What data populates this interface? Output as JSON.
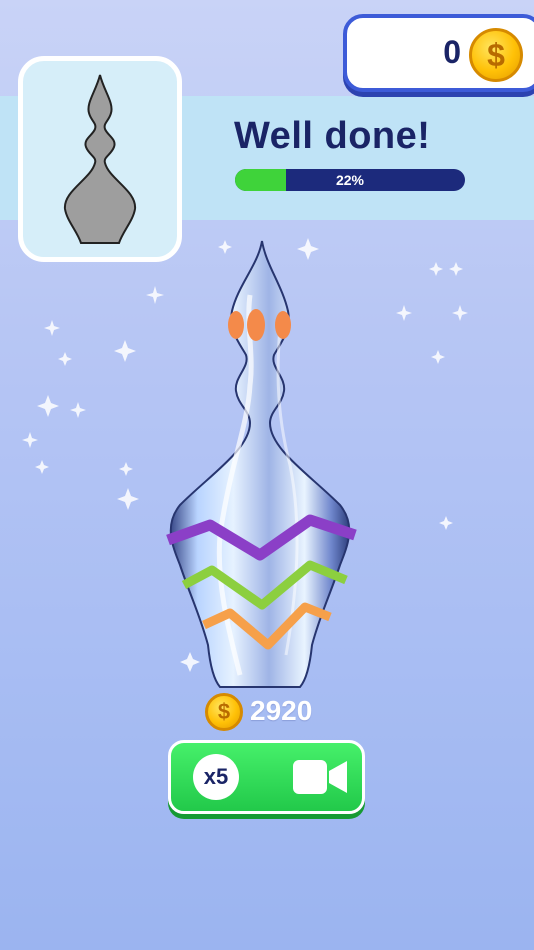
{
  "hud": {
    "coins": "0",
    "coin_icon": "dollar-coin-icon",
    "coin_symbol": "$"
  },
  "level": {
    "title": "Well done!",
    "progress_label": "22%",
    "progress_fraction": 0.22,
    "target_shape_icon": "vase-silhouette-icon"
  },
  "reward": {
    "amount": "2920",
    "coin_symbol": "$"
  },
  "claim_button": {
    "multiplier": "x5",
    "icon": "video-camera-icon"
  },
  "colors": {
    "accent_blue": "#1a2466",
    "progress_green": "#3fd33a",
    "button_green": "#22c94a",
    "stripe_purple": "#8b3fc7",
    "stripe_green": "#8ccf3f",
    "stripe_orange": "#f6a04a",
    "dot_orange": "#f48a4a"
  }
}
